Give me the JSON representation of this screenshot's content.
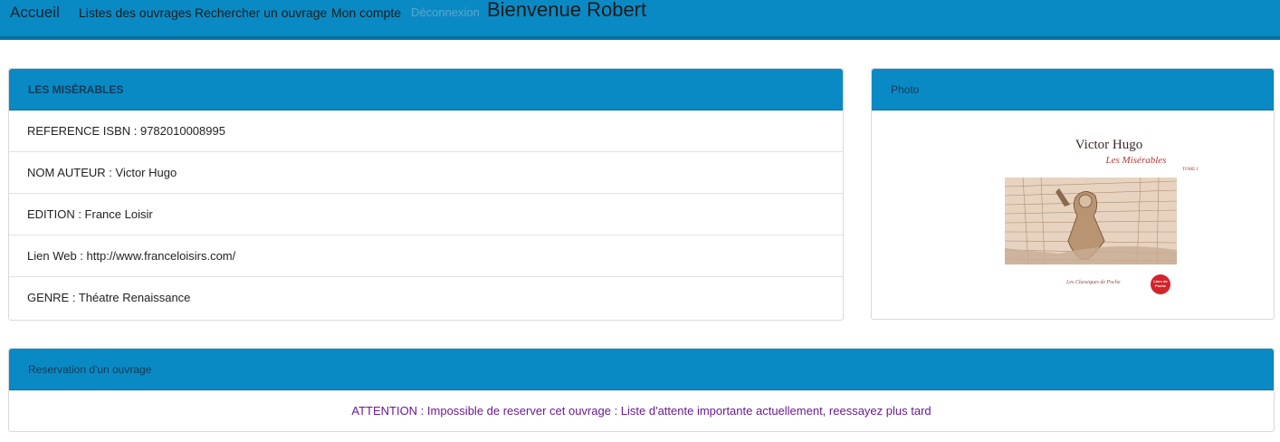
{
  "nav": {
    "brand": "Accueil",
    "items": [
      {
        "label": "Listes des ouvrages"
      },
      {
        "label": "Rechercher un ouvrage"
      },
      {
        "label": "Mon compte"
      },
      {
        "label": "Déconnexion"
      }
    ],
    "welcome": "Bienvenue Robert"
  },
  "book": {
    "title": "LES MISÉRABLES",
    "rows": [
      {
        "text": "REFERENCE ISBN : 9782010008995"
      },
      {
        "text": "NOM AUTEUR : Victor Hugo"
      },
      {
        "text": "EDITION : France Loisir"
      },
      {
        "text": "Lien Web : http://www.franceloisirs.com/"
      },
      {
        "text": "GENRE : Théatre Renaissance"
      }
    ]
  },
  "photo": {
    "heading": "Photo",
    "cover": {
      "author": "Victor Hugo",
      "title": "Les Misérables",
      "tome": "TOME 1",
      "collection": "Les Classiques de Poche",
      "logo": "Livre de Poche"
    }
  },
  "reservation": {
    "heading": "Reservation d'un ouvrage",
    "warning": "ATTENTION : Impossible de reserver cet ouvrage : Liste d'attente importante actuellement, reessayez plus tard"
  }
}
